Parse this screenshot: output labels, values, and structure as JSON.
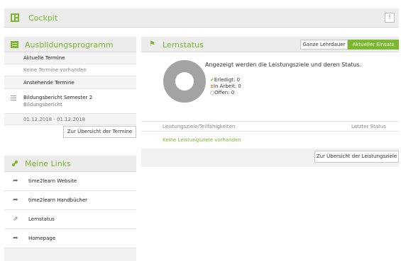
{
  "topbar": {
    "title": "Cockpit",
    "menu_glyph": "⁝",
    "icon": "dashboard-icon"
  },
  "ausbildung": {
    "title": "Ausbildungsprogramm",
    "icon": "calendar-icon",
    "current_header": "Aktuelle Termine",
    "no_appointments": "Keine Termine vorhanden",
    "upcoming_header": "Anstehende Termine",
    "entry_title": "Bildungsbericht Semester 2",
    "entry_subtitle": "Bildungsbericht",
    "entry_date": "01.12.2018 - 01.12.2018",
    "overview_button": "Zur Übersicht der Termine"
  },
  "links": {
    "title": "Meine Links",
    "icon": "link-icon",
    "items": [
      {
        "label": "time2learn Website",
        "icon": "share-arrow-icon"
      },
      {
        "label": "time2learn Handbücher",
        "icon": "share-arrow-icon"
      },
      {
        "label": "Lernstatus",
        "icon": "pin-icon"
      },
      {
        "label": "Homepage",
        "icon": "share-arrow-icon"
      }
    ]
  },
  "lernstatus": {
    "title": "Lernstatus",
    "icon": "flag-icon",
    "toggle_full": "Ganze Lehrdauer",
    "toggle_current": "Aktueller Einsatz",
    "description": "Angezeigt werden die Leistungsziele und deren Status.",
    "legend": [
      {
        "label": "Erledigt:",
        "count": "0",
        "glyph": "✔"
      },
      {
        "label": "In Arbeit:",
        "count": "0",
        "glyph": "⧗"
      },
      {
        "label": "Offen:",
        "count": "0",
        "glyph": "○"
      }
    ],
    "col_goals": "Leistungsziele/Teilfähigkeiten",
    "col_status": "Letzter Status",
    "empty_text": "Keine Leistungsziele vorhanden",
    "overview_button": "Zur Übersicht der Leistungsziele"
  },
  "colors": {
    "accent": "#7cb82f",
    "donut": "#a3a3a3",
    "panel_header": "#ececec"
  }
}
